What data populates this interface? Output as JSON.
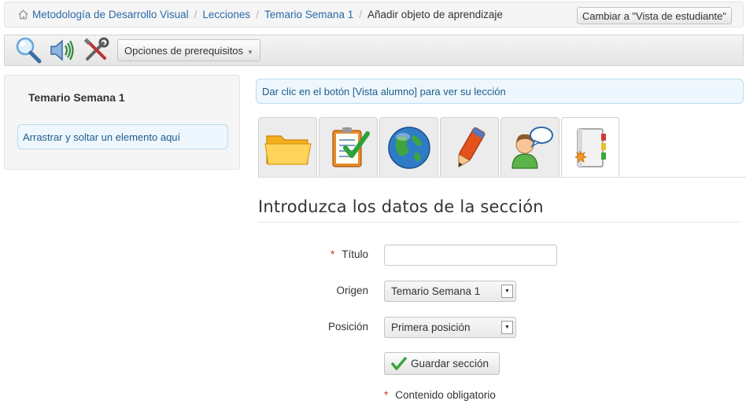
{
  "breadcrumb": {
    "items": [
      "Metodología de Desarrollo Visual",
      "Lecciones",
      "Temario Semana 1"
    ],
    "current": "Añadir objeto de aprendizaje",
    "separator": "/"
  },
  "header": {
    "switch_button": "Cambiar a \"Vista de estudiante\""
  },
  "toolbar": {
    "icons": [
      "search-zoom-icon",
      "speaker-icon",
      "tools-icon"
    ],
    "prereq_button": "Opciones de prerequisitos"
  },
  "sidebar": {
    "title": "Temario Semana 1",
    "dropzone": "Arrastrar y soltar un elemento aquí"
  },
  "info": {
    "message": "Dar clic en el botón [Vista alumno] para ver su lección"
  },
  "tabs": {
    "icons": [
      "folder-icon",
      "checklist-icon",
      "globe-icon",
      "pencil-icon",
      "user-chat-icon",
      "notebook-icon"
    ],
    "active_index": 5
  },
  "form": {
    "title": "Introduzca los datos de la sección",
    "titulo_label": "Título",
    "titulo_value": "",
    "origen_label": "Origen",
    "origen_value": "Temario Semana 1",
    "posicion_label": "Posición",
    "posicion_value": "Primera posición",
    "save_button": "Guardar sección",
    "required_mark": "*",
    "required_note": "Contenido obligatorio"
  },
  "colors": {
    "link": "#2a6aa8",
    "info_bg": "#eef7fd",
    "info_border": "#b8dcf0",
    "required": "#c0392b"
  }
}
